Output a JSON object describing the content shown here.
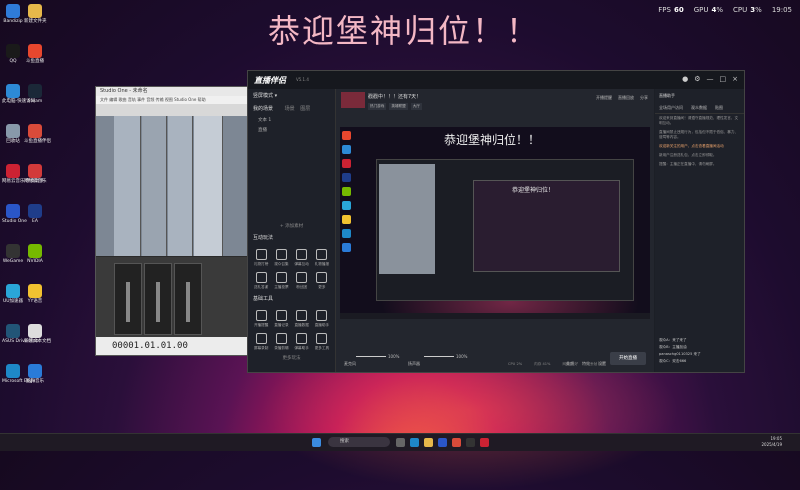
{
  "headline": "恭迎堡神归位！！",
  "overlay": {
    "fps": {
      "label": "FPS",
      "value": "60"
    },
    "gpu": {
      "label": "GPU",
      "value": "4",
      "unit": "%"
    },
    "cpu": {
      "label": "CPU",
      "value": "3",
      "unit": "%"
    },
    "time": "19:05"
  },
  "desktop_icons": [
    {
      "label": "Bandizip",
      "color": "#2f7bd8"
    },
    {
      "label": "新建文件夹",
      "color": "#e6b84a"
    },
    {
      "label": "QQ",
      "color": "#1a1a1a"
    },
    {
      "label": "斗鱼直播",
      "color": "#e8472e"
    },
    {
      "label": "此电脑-快速访问",
      "color": "#2d8ad6"
    },
    {
      "label": "Steam",
      "color": "#1b2838"
    },
    {
      "label": "回收站",
      "color": "#8899aa"
    },
    {
      "label": "斗鱼直播伴侣",
      "color": "#d94b3a"
    },
    {
      "label": "网易云音乐 伴奏助手",
      "color": "#cc2233"
    },
    {
      "label": "网易云音乐",
      "color": "#d33a3a"
    },
    {
      "label": "Studio One",
      "color": "#2a56c8"
    },
    {
      "label": "EA",
      "color": "#1f3d8a"
    },
    {
      "label": "WeGame",
      "color": "#333333"
    },
    {
      "label": "NVIDIA",
      "color": "#76b900"
    },
    {
      "label": "UU加速器",
      "color": "#2aa6d8"
    },
    {
      "label": "YY语音",
      "color": "#f2c230"
    },
    {
      "label": "ASUS DriverHub",
      "color": "#225577"
    },
    {
      "label": "新建文本文档",
      "color": "#dddddd"
    },
    {
      "label": "Microsoft Edge",
      "color": "#1e88c8"
    },
    {
      "label": "酷狗音乐",
      "color": "#2a7bd8"
    }
  ],
  "daw": {
    "title": "Studio One - 未命名",
    "menu": "文件 编辑 歌曲 音轨 事件 音频 传输 视图 Studio One 帮助",
    "timecode": "00001.01.01.00"
  },
  "app": {
    "logo": "直播伴侣",
    "version": "V5.1.4",
    "header_right": [
      "头像",
      "设置",
      "—",
      "□",
      "×"
    ],
    "sidebar": {
      "mode_label": "竖屏模式",
      "scene_title": "我的场景",
      "scene_tabs": [
        "场景",
        "图层"
      ],
      "scene_items": [
        "文本 1",
        "直播"
      ],
      "add_scene": "+ 添加素材",
      "interactive_title": "互动玩法",
      "interactive_tools": [
        "礼物打榜",
        "观众召集",
        "弹幕互动",
        "礼物播报",
        "送礼答谢",
        "主播投票",
        "粉丝团",
        "更多"
      ],
      "basic_title": "基础工具",
      "basic_tools": [
        "开播提醒",
        "直播记录",
        "直播数据",
        "直播助手",
        "屏幕录制",
        "录播剪辑",
        "弹幕助手",
        "更多工具"
      ],
      "more_link": "更多玩法"
    },
    "stream": {
      "name": "戳戳中！！！还有7天！",
      "tags": [
        "热门游戏",
        "英雄联盟",
        "大厅"
      ],
      "controls": [
        "开播提醒",
        "直播回放",
        "分享"
      ]
    },
    "preview": {
      "title": "恭迎堡神归位！！",
      "inner_title": "恭迎堡神归位！"
    },
    "controls": {
      "mic_label": "麦克风",
      "mic_value": "100%",
      "speaker_label": "扬声器",
      "speaker_value": "100%",
      "buttons": [
        "美颜",
        "特效",
        "设置"
      ],
      "start_button": "开始直播"
    },
    "right_panel": {
      "title": "直播助手",
      "tabs": [
        "全场用户访问",
        "观众数据",
        "贴图"
      ],
      "notices": [
        "欢迎来到直播间！请遵守直播规范，理性发言，文明互动。",
        "直播间禁止违规行为，包括但不限于低俗、暴力、谩骂等内容。",
        "新用户注册送礼包，点击立即领取。",
        "提醒：主播正在直播中，请勿刷屏。"
      ],
      "highlight": "欢迎新关注的用户，点击查看直播间活动",
      "chat": [
        "观众A：来了来了",
        "观众B：主播加油",
        "panaschg0110325 来了",
        "观众C：双击666"
      ]
    },
    "status_bar": [
      "CPU 2%",
      "内存 41%",
      "网络 良好",
      "丢帧 0%"
    ]
  },
  "taskbar": {
    "search_placeholder": "搜索",
    "clock_time": "19:05",
    "clock_date": "2025/4/19"
  }
}
